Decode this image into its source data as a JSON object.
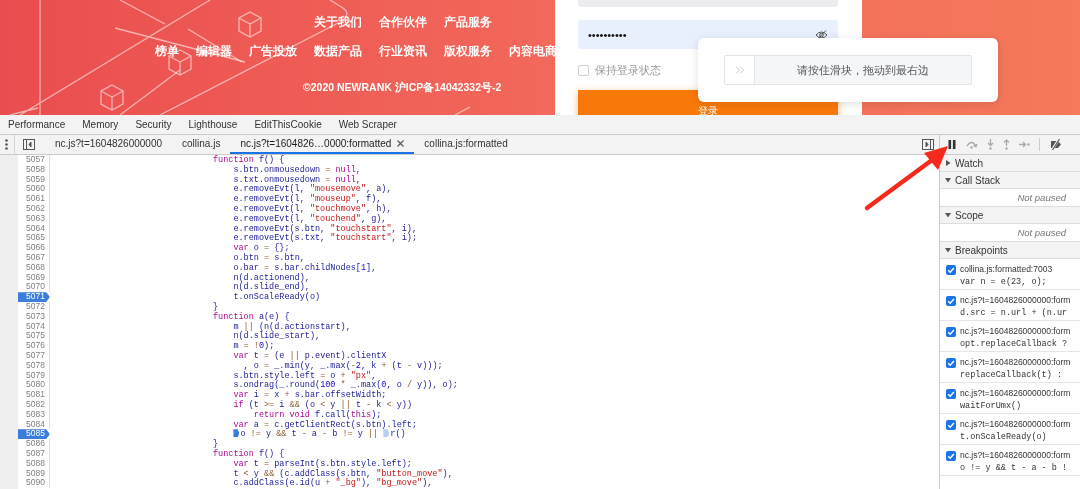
{
  "website": {
    "nav_rows": [
      {
        "items": [
          "关于我们",
          "合作伙伴",
          "产品服务"
        ]
      },
      {
        "items": [
          "榜单",
          "编辑器",
          "广告投放",
          "数据产品",
          "行业资讯",
          "版权服务",
          "内容电商"
        ]
      }
    ],
    "copyright": "©2020 NEWRANK 沪ICP备14042332号-2",
    "login": {
      "password_value": "••••••••••",
      "remember_label": "保持登录状态",
      "remember_checked": false,
      "login_button": "登录"
    },
    "slider_captcha": {
      "level": 0,
      "hint": "请按住滑块，拖动到最右边"
    }
  },
  "devtools": {
    "panel_tabs": [
      "Performance",
      "Memory",
      "Security",
      "Lighthouse",
      "EditThisCookie",
      "Web Scraper"
    ],
    "file_tabs": [
      {
        "label": "nc.js?t=1604826000000",
        "selected": false
      },
      {
        "label": "collina.js",
        "selected": false
      },
      {
        "label": "nc.js?t=1604826…0000:formatted",
        "selected": true
      },
      {
        "label": "collina.js:formatted",
        "selected": false
      }
    ],
    "code_lines": [
      {
        "number": "5057",
        "breakpoint": false,
        "tokens": [
          {
            "kind": "keyword",
            "text": "function"
          },
          {
            "kind": "identifier",
            "text": " f() {"
          }
        ]
      },
      {
        "number": "5058",
        "breakpoint": false,
        "tokens": [
          {
            "kind": "identifier",
            "text": "    s.btn.onmousedown"
          },
          {
            "kind": "operator",
            "text": " = "
          },
          {
            "kind": "keyword",
            "text": "null"
          },
          {
            "kind": "identifier",
            "text": ","
          }
        ]
      },
      {
        "number": "5059",
        "breakpoint": false,
        "tokens": [
          {
            "kind": "identifier",
            "text": "    s.txt.onmousedown"
          },
          {
            "kind": "operator",
            "text": " = "
          },
          {
            "kind": "keyword",
            "text": "null"
          },
          {
            "kind": "identifier",
            "text": ","
          }
        ]
      },
      {
        "number": "5060",
        "breakpoint": false,
        "tokens": [
          {
            "kind": "identifier",
            "text": "    e.removeEvt(l, "
          },
          {
            "kind": "string",
            "text": "\"mousemove\""
          },
          {
            "kind": "identifier",
            "text": ", a),"
          }
        ]
      },
      {
        "number": "5061",
        "breakpoint": false,
        "tokens": [
          {
            "kind": "identifier",
            "text": "    e.removeEvt(l, "
          },
          {
            "kind": "string",
            "text": "\"mouseup\""
          },
          {
            "kind": "identifier",
            "text": ", f),"
          }
        ]
      },
      {
        "number": "5062",
        "breakpoint": false,
        "tokens": [
          {
            "kind": "identifier",
            "text": "    e.removeEvt(l, "
          },
          {
            "kind": "string",
            "text": "\"touchmove\""
          },
          {
            "kind": "identifier",
            "text": ", h),"
          }
        ]
      },
      {
        "number": "5063",
        "breakpoint": false,
        "tokens": [
          {
            "kind": "identifier",
            "text": "    e.removeEvt(l, "
          },
          {
            "kind": "string",
            "text": "\"touchend\""
          },
          {
            "kind": "identifier",
            "text": ", g),"
          }
        ]
      },
      {
        "number": "5064",
        "breakpoint": false,
        "tokens": [
          {
            "kind": "identifier",
            "text": "    e.removeEvt(s.btn, "
          },
          {
            "kind": "string",
            "text": "\"touchstart\""
          },
          {
            "kind": "identifier",
            "text": ", i),"
          }
        ]
      },
      {
        "number": "5065",
        "breakpoint": false,
        "tokens": [
          {
            "kind": "identifier",
            "text": "    e.removeEvt(s.txt, "
          },
          {
            "kind": "string",
            "text": "\"touchstart\""
          },
          {
            "kind": "identifier",
            "text": ", i);"
          }
        ]
      },
      {
        "number": "5066",
        "breakpoint": false,
        "tokens": [
          {
            "kind": "keyword",
            "text": "    var"
          },
          {
            "kind": "identifier",
            "text": " o"
          },
          {
            "kind": "operator",
            "text": " = "
          },
          {
            "kind": "identifier",
            "text": "{};"
          }
        ]
      },
      {
        "number": "5067",
        "breakpoint": false,
        "tokens": [
          {
            "kind": "identifier",
            "text": "    o.btn"
          },
          {
            "kind": "operator",
            "text": " = "
          },
          {
            "kind": "identifier",
            "text": "s.btn,"
          }
        ]
      },
      {
        "number": "5068",
        "breakpoint": false,
        "tokens": [
          {
            "kind": "identifier",
            "text": "    o.bar"
          },
          {
            "kind": "operator",
            "text": " = "
          },
          {
            "kind": "identifier",
            "text": "s.bar.childNodes["
          },
          {
            "kind": "number",
            "text": "1"
          },
          {
            "kind": "identifier",
            "text": "],"
          }
        ]
      },
      {
        "number": "5069",
        "breakpoint": false,
        "tokens": [
          {
            "kind": "identifier",
            "text": "    n(d.actionend),"
          }
        ]
      },
      {
        "number": "5070",
        "breakpoint": false,
        "tokens": [
          {
            "kind": "identifier",
            "text": "    n(d.slide_end),"
          }
        ]
      },
      {
        "number": "5071",
        "breakpoint": true,
        "tokens": [
          {
            "kind": "identifier",
            "text": "    t.onScaleReady(o)"
          }
        ]
      },
      {
        "number": "5072",
        "breakpoint": false,
        "tokens": [
          {
            "kind": "identifier",
            "text": "}"
          }
        ]
      },
      {
        "number": "5073",
        "breakpoint": false,
        "tokens": [
          {
            "kind": "keyword",
            "text": "function"
          },
          {
            "kind": "identifier",
            "text": " a(e) {"
          }
        ]
      },
      {
        "number": "5074",
        "breakpoint": false,
        "tokens": [
          {
            "kind": "identifier",
            "text": "    m"
          },
          {
            "kind": "operator",
            "text": " || "
          },
          {
            "kind": "identifier",
            "text": "(n(d.actionstart),"
          }
        ]
      },
      {
        "number": "5075",
        "breakpoint": false,
        "tokens": [
          {
            "kind": "identifier",
            "text": "    n(d.slide_start),"
          }
        ]
      },
      {
        "number": "5076",
        "breakpoint": false,
        "tokens": [
          {
            "kind": "identifier",
            "text": "    m"
          },
          {
            "kind": "operator",
            "text": " = !"
          },
          {
            "kind": "number",
            "text": "0"
          },
          {
            "kind": "identifier",
            "text": ");"
          }
        ]
      },
      {
        "number": "5077",
        "breakpoint": false,
        "tokens": [
          {
            "kind": "keyword",
            "text": "    var"
          },
          {
            "kind": "identifier",
            "text": " t"
          },
          {
            "kind": "operator",
            "text": " = "
          },
          {
            "kind": "identifier",
            "text": "(e"
          },
          {
            "kind": "operator",
            "text": " || "
          },
          {
            "kind": "identifier",
            "text": "p.event).clientX"
          }
        ]
      },
      {
        "number": "5078",
        "breakpoint": false,
        "tokens": [
          {
            "kind": "identifier",
            "text": "      , o"
          },
          {
            "kind": "operator",
            "text": " = "
          },
          {
            "kind": "identifier",
            "text": "_.min(y, _.max("
          },
          {
            "kind": "operator",
            "text": "-"
          },
          {
            "kind": "number",
            "text": "2"
          },
          {
            "kind": "identifier",
            "text": ", k"
          },
          {
            "kind": "operator",
            "text": " + "
          },
          {
            "kind": "identifier",
            "text": "(t"
          },
          {
            "kind": "operator",
            "text": " - "
          },
          {
            "kind": "identifier",
            "text": "v)));"
          }
        ]
      },
      {
        "number": "5079",
        "breakpoint": false,
        "tokens": [
          {
            "kind": "identifier",
            "text": "    s.btn.style.left"
          },
          {
            "kind": "operator",
            "text": " = "
          },
          {
            "kind": "identifier",
            "text": "o"
          },
          {
            "kind": "operator",
            "text": " + "
          },
          {
            "kind": "string",
            "text": "\"px\""
          },
          {
            "kind": "identifier",
            "text": ","
          }
        ]
      },
      {
        "number": "5080",
        "breakpoint": false,
        "tokens": [
          {
            "kind": "identifier",
            "text": "    s.ondrag(_.round("
          },
          {
            "kind": "number",
            "text": "100"
          },
          {
            "kind": "operator",
            "text": " * "
          },
          {
            "kind": "identifier",
            "text": "_.max("
          },
          {
            "kind": "number",
            "text": "0"
          },
          {
            "kind": "identifier",
            "text": ", o"
          },
          {
            "kind": "operator",
            "text": " / "
          },
          {
            "kind": "identifier",
            "text": "y)), o);"
          }
        ]
      },
      {
        "number": "5081",
        "breakpoint": false,
        "tokens": [
          {
            "kind": "keyword",
            "text": "    var"
          },
          {
            "kind": "identifier",
            "text": " i"
          },
          {
            "kind": "operator",
            "text": " = "
          },
          {
            "kind": "identifier",
            "text": "x"
          },
          {
            "kind": "operator",
            "text": " + "
          },
          {
            "kind": "identifier",
            "text": "s.bar.offsetWidth;"
          }
        ]
      },
      {
        "number": "5082",
        "breakpoint": false,
        "tokens": [
          {
            "kind": "keyword",
            "text": "    if"
          },
          {
            "kind": "identifier",
            "text": " (t"
          },
          {
            "kind": "operator",
            "text": " >= "
          },
          {
            "kind": "identifier",
            "text": "i"
          },
          {
            "kind": "operator",
            "text": " && "
          },
          {
            "kind": "identifier",
            "text": "(o"
          },
          {
            "kind": "operator",
            "text": " < "
          },
          {
            "kind": "identifier",
            "text": "y"
          },
          {
            "kind": "operator",
            "text": " || "
          },
          {
            "kind": "identifier",
            "text": "t"
          },
          {
            "kind": "operator",
            "text": " - "
          },
          {
            "kind": "identifier",
            "text": "k"
          },
          {
            "kind": "operator",
            "text": " < "
          },
          {
            "kind": "identifier",
            "text": "y))"
          }
        ]
      },
      {
        "number": "5083",
        "breakpoint": false,
        "tokens": [
          {
            "kind": "keyword",
            "text": "        return void"
          },
          {
            "kind": "identifier",
            "text": " f.call("
          },
          {
            "kind": "keyword",
            "text": "this"
          },
          {
            "kind": "identifier",
            "text": ");"
          }
        ]
      },
      {
        "number": "5084",
        "breakpoint": false,
        "tokens": [
          {
            "kind": "keyword",
            "text": "    var"
          },
          {
            "kind": "identifier",
            "text": " a"
          },
          {
            "kind": "operator",
            "text": " = "
          },
          {
            "kind": "identifier",
            "text": "c.getClientRect(s.btn).left;"
          }
        ]
      },
      {
        "number": "5085",
        "breakpoint": true,
        "tokens": [
          {
            "kind": "marker",
            "active": true,
            "text": "    o"
          },
          {
            "kind": "operator",
            "text": " != "
          },
          {
            "kind": "identifier",
            "text": "y"
          },
          {
            "kind": "operator",
            "text": " && "
          },
          {
            "kind": "identifier",
            "text": "t"
          },
          {
            "kind": "operator",
            "text": " - "
          },
          {
            "kind": "identifier",
            "text": "a"
          },
          {
            "kind": "operator",
            "text": " - "
          },
          {
            "kind": "identifier",
            "text": "b"
          },
          {
            "kind": "operator",
            "text": " != "
          },
          {
            "kind": "identifier",
            "text": "y"
          },
          {
            "kind": "operator",
            "text": " || "
          },
          {
            "kind": "marker",
            "active": false,
            "text": "r()"
          }
        ]
      },
      {
        "number": "5086",
        "breakpoint": false,
        "tokens": [
          {
            "kind": "identifier",
            "text": "}"
          }
        ]
      },
      {
        "number": "5087",
        "breakpoint": false,
        "tokens": [
          {
            "kind": "keyword",
            "text": "function"
          },
          {
            "kind": "identifier",
            "text": " f() {"
          }
        ]
      },
      {
        "number": "5088",
        "breakpoint": false,
        "tokens": [
          {
            "kind": "keyword",
            "text": "    var"
          },
          {
            "kind": "identifier",
            "text": " t"
          },
          {
            "kind": "operator",
            "text": " = "
          },
          {
            "kind": "identifier",
            "text": "parseInt(s.btn.style.left);"
          }
        ]
      },
      {
        "number": "5089",
        "breakpoint": false,
        "tokens": [
          {
            "kind": "identifier",
            "text": "    t"
          },
          {
            "kind": "operator",
            "text": " < "
          },
          {
            "kind": "identifier",
            "text": "y"
          },
          {
            "kind": "operator",
            "text": " && "
          },
          {
            "kind": "identifier",
            "text": "(c.addClass(s.btn, "
          },
          {
            "kind": "string",
            "text": "\"button_move\""
          },
          {
            "kind": "identifier",
            "text": "),"
          }
        ]
      },
      {
        "number": "5090",
        "breakpoint": false,
        "tokens": [
          {
            "kind": "identifier",
            "text": "    c.addClass(e.id(u"
          },
          {
            "kind": "operator",
            "text": " + "
          },
          {
            "kind": "string",
            "text": "\"_bg\""
          },
          {
            "kind": "identifier",
            "text": "), "
          },
          {
            "kind": "string",
            "text": "\"bg_move\""
          },
          {
            "kind": "identifier",
            "text": "),"
          }
        ]
      }
    ],
    "sections": [
      {
        "kind": "plain",
        "title": "Watch",
        "expanded": false
      },
      {
        "kind": "message",
        "title": "Call Stack",
        "expanded": true,
        "message": "Not paused"
      },
      {
        "kind": "message",
        "title": "Scope",
        "expanded": true,
        "message": "Not paused"
      },
      {
        "kind": "breakpoints",
        "title": "Breakpoints",
        "expanded": true,
        "breakpoints": [
          {
            "location": "collina.js:formatted:7003",
            "code": "var n = e(23, o);",
            "checked": true
          },
          {
            "location": "nc.js?t=1604826000000:form",
            "code": "d.src = n.url + (n.ur",
            "checked": true
          },
          {
            "location": "nc.js?t=1604826000000:form",
            "code": "opt.replaceCallback ?",
            "checked": true
          },
          {
            "location": "nc.js?t=1604826000000:form",
            "code": "replaceCallback(t) :",
            "checked": true
          },
          {
            "location": "nc.js?t=1604826000000:form",
            "code": "waitForUmx()",
            "checked": true
          },
          {
            "location": "nc.js?t=1604826000000:form",
            "code": "t.onScaleReady(o)",
            "checked": true
          },
          {
            "location": "nc.js?t=1604826000000:form",
            "code": "o != y && t - a - b !",
            "checked": true
          }
        ]
      }
    ]
  }
}
